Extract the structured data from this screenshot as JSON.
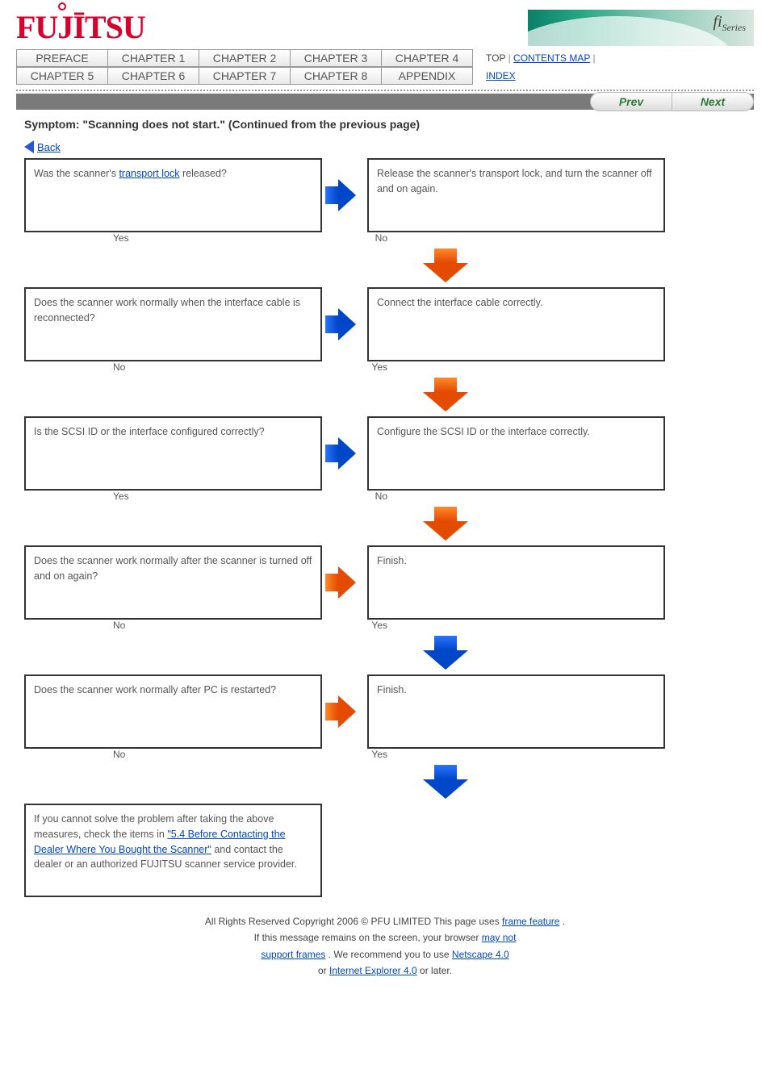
{
  "logo_text": "FUJĪTSU",
  "banner_fi": "fi",
  "banner_series": "Series",
  "nav": {
    "row1": [
      "PREFACE",
      "CHAPTER 1",
      "CHAPTER 2",
      "CHAPTER 3",
      "CHAPTER 4"
    ],
    "row2": [
      "CHAPTER 5",
      "CHAPTER 6",
      "CHAPTER 7",
      "CHAPTER 8",
      "APPENDIX"
    ],
    "top": "TOP",
    "contents_link": "CONTENTS MAP",
    "index_link": "INDEX"
  },
  "prev": "Prev",
  "next": "Next",
  "section_title": "Symptom: \"Scanning does not start.\" (Continued from the previous page)",
  "back": "Back",
  "yes": "Yes",
  "no": "No",
  "steps": [
    {
      "left_pre": "Was the scanner's ",
      "left_link": "transport lock",
      "left_post": " released?",
      "right": "Release the scanner's transport lock, and turn the scanner off and on again.",
      "side": "blue"
    },
    {
      "left": "Does the scanner work normally when the interface cable is reconnected?",
      "right": "Connect the interface cable correctly.",
      "side": "blue"
    },
    {
      "left": "Is the SCSI ID or the interface configured correctly?",
      "right": "Configure the SCSI ID or the interface correctly.",
      "side": "blue"
    },
    {
      "left": "Does the scanner work normally after the scanner is turned off and on again?",
      "right": "Finish.",
      "side": "orange"
    },
    {
      "left": "Does the scanner work normally after PC is restarted?",
      "right": "Finish.",
      "side": "orange"
    }
  ],
  "final": {
    "text1": "If you cannot solve the problem after taking the above measures, check the items in ",
    "link1": "\"5.4 Before Contacting the Dealer Where You Bought the Scanner\"",
    "text2": " and contact the dealer or an authorized FUJITSU scanner service provider."
  },
  "footer": {
    "l1a": "All Rights Reserved Copyright 2006 © PFU LIMITED",
    "l1b": "This page uses ",
    "l1c": "frame feature",
    "l1d": ".",
    "l2a": "If this message remains on the screen, your browser ",
    "l2b": "may not",
    "l3a": "support frames",
    "l3b": ". We recommend you to use ",
    "l3c": "Netscape 4.0",
    "l4a": "or ",
    "l4b": "Internet Explorer 4.0",
    "l4c": " or later."
  }
}
